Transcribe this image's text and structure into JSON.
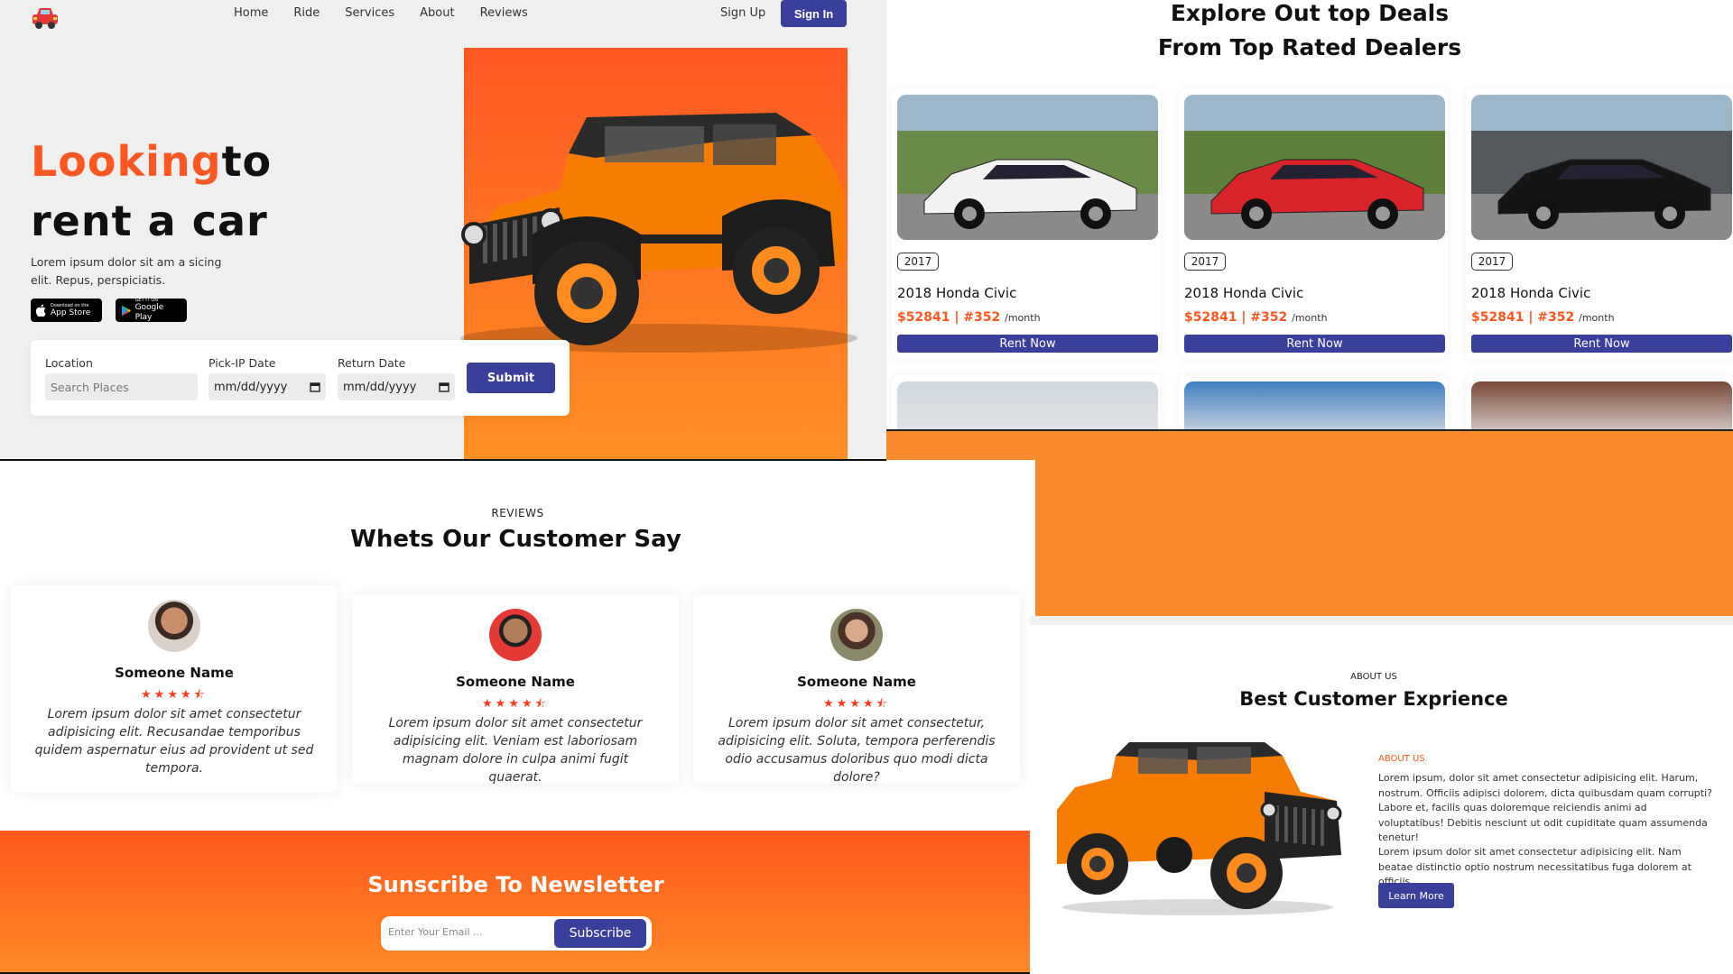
{
  "colors": {
    "accent": "#ff5722",
    "primary_button": "#3b3f9c",
    "orange": "#f98a2c"
  },
  "nav": {
    "links": [
      "Home",
      "Ride",
      "Services",
      "About",
      "Reviews"
    ],
    "sign_up": "Sign Up",
    "sign_in": "Sign In",
    "logo_icon": "car-icon"
  },
  "hero": {
    "title_highlight": "Looking",
    "title_rest_1": "to",
    "title_line_2": "rent a car",
    "description": "Lorem ipsum dolor sit am a sicing elit. Repus, perspiciatis.",
    "app_store": {
      "small": "Download on the",
      "big": "App Store"
    },
    "google_play": {
      "small": "GET IT ON",
      "big": "Google Play"
    }
  },
  "booking": {
    "location_label": "Location",
    "location_placeholder": "Search Places",
    "pickup_label": "Pick-IP Date",
    "pickup_value": "mm/dd/yyyy",
    "return_label": "Return Date",
    "return_value": "mm/dd/yyyy",
    "submit": "Submit"
  },
  "deals": {
    "title_line_1": "Explore Out top Deals",
    "title_line_2": "From Top Rated Dealers",
    "cards": [
      {
        "year": "2017",
        "name": "2018 Honda Civic",
        "price": "$52841 | #352",
        "per": "/month",
        "button": "Rent Now",
        "car_color": "#f2f2f2"
      },
      {
        "year": "2017",
        "name": "2018 Honda Civic",
        "price": "$52841 | #352",
        "per": "/month",
        "button": "Rent Now",
        "car_color": "#d8232a"
      },
      {
        "year": "2017",
        "name": "2018 Honda Civic",
        "price": "$52841 | #352",
        "per": "/month",
        "button": "Rent Now",
        "car_color": "#151515"
      }
    ]
  },
  "reviews": {
    "kicker": "REVIEWS",
    "title": "Whets Our Customer Say",
    "items": [
      {
        "name": "Someone Name",
        "stars": "★★★★⯪",
        "rating": 4.5,
        "text": "Lorem ipsum dolor sit amet consectetur adipisicing elit. Recusandae temporibus quidem aspernatur eius ad provident ut sed tempora."
      },
      {
        "name": "Someone Name",
        "stars": "★★★★⯪",
        "rating": 4.5,
        "text": "Lorem ipsum dolor sit amet consectetur adipisicing elit. Veniam est laboriosam magnam dolore in culpa animi fugit quaerat."
      },
      {
        "name": "Someone Name",
        "stars": "★★★★⯪",
        "rating": 4.5,
        "text": "Lorem ipsum dolor sit amet consectetur, adipisicing elit. Soluta, tempora perferendis odio accusamus doloribus quo modi dicta dolore?"
      }
    ]
  },
  "newsletter": {
    "title": "Sunscribe To Newsletter",
    "placeholder": "Enter Your Email ...",
    "button": "Subscribe"
  },
  "about": {
    "kicker": "ABOUT US",
    "title": "Best Customer Exprience",
    "sub": "ABOUT US",
    "p1": "Lorem ipsum, dolor sit amet consectetur adipisicing elit. Harum, nostrum. Officiis adipisci dolorem, dicta quibusdam quam corrupti? Labore et, facilis quas doloremque reiciendis animi ad voluptatibus! Debitis nesciunt ut odit cupiditate quam assumenda tenetur!",
    "p2": "Lorem ipsum dolor sit amet consectetur adipisicing elit. Nam beatae distinctio optio nostrum necessitatibus fuga dolorem at officiis.",
    "button": "Learn More"
  }
}
